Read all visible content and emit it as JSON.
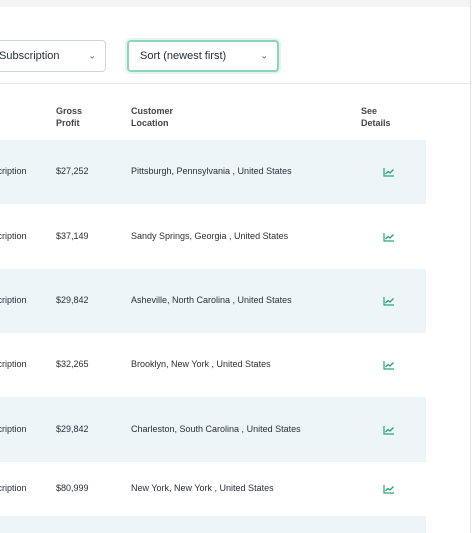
{
  "filters": {
    "type_select_value": "Subscription",
    "sort_select_value": "Sort (newest first)",
    "chevron": "⌄"
  },
  "table": {
    "headers": {
      "gross_profit": [
        "Gross",
        "Profit"
      ],
      "customer_location": [
        "Customer",
        "Location"
      ],
      "see_details": [
        "See",
        "Details"
      ]
    },
    "rows": [
      {
        "type": "Subscription",
        "gross_profit": "$27,252",
        "location": "Pittsburgh, Pennsylvania , United States",
        "icon": "chart-line-icon"
      },
      {
        "type": "Subscription",
        "gross_profit": "$37,149",
        "location": "Sandy Springs, Georgia , United States",
        "icon": "chart-line-icon"
      },
      {
        "type": "Subscription",
        "gross_profit": "$29,842",
        "location": "Asheville, North Carolina , United States",
        "icon": "chart-line-icon"
      },
      {
        "type": "Subscription",
        "gross_profit": "$32,265",
        "location": "Brooklyn, New York , United States",
        "icon": "chart-line-icon"
      },
      {
        "type": "Subscription",
        "gross_profit": "$29,842",
        "location": "Charleston, South Carolina , United States",
        "icon": "chart-line-icon"
      },
      {
        "type": "Subscription",
        "gross_profit": "$80,999",
        "location": "New York, New York , United States",
        "icon": "chart-line-icon"
      }
    ]
  },
  "colors": {
    "accent": "#2aa37a",
    "row_alt": "#eef5f9",
    "focus_border": "#8fd3bd"
  }
}
